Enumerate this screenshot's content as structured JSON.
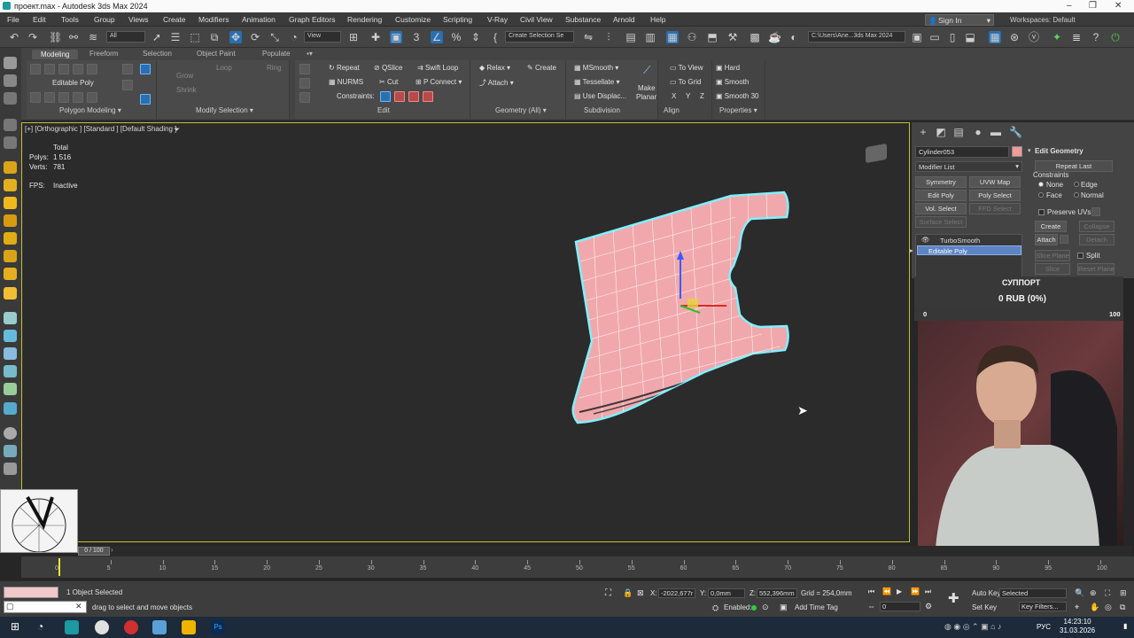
{
  "app": {
    "title": "проект.max - Autodesk 3ds Max 2024"
  },
  "menu": [
    "File",
    "Edit",
    "Tools",
    "Group",
    "Views",
    "Create",
    "Modifiers",
    "Animation",
    "Graph Editors",
    "Rendering",
    "Customize",
    "Scripting",
    "V-Ray",
    "Civil View",
    "Substance",
    "Arnold",
    "Help"
  ],
  "signin": {
    "label": "Sign In"
  },
  "workspaces": {
    "label": "Workspaces:",
    "value": "Default"
  },
  "toolbar": {
    "filter": "All",
    "refcoord": "View",
    "selset": "Create Selection Se",
    "path": "C:\\Users\\Ane...3ds Max 2024"
  },
  "ribbon": {
    "tabs": [
      "Modeling",
      "Freeform",
      "Selection",
      "Object Paint",
      "Populate"
    ],
    "editable_poly": "Editable Poly",
    "sel_grey": {
      "grow": "Grow",
      "shrink": "Shrink",
      "loop": "Loop",
      "ring": "Ring"
    },
    "edit": {
      "repeat": "Repeat",
      "qslice": "QSlice",
      "swift_loop": "Swift Loop",
      "nurms": "NURMS",
      "cut": "Cut",
      "p_connect": "P Connect",
      "constraints": "Constraints:"
    },
    "geometry": {
      "relax": "Relax",
      "create": "Create",
      "attach": "Attach"
    },
    "subdivision": {
      "msmooth": "MSmooth",
      "tessellate": "Tessellate",
      "use_displac": "Use Displac..."
    },
    "align": {
      "make_planar_1": "Make",
      "make_planar_2": "Planar",
      "to_view": "To View",
      "to_grid": "To Grid",
      "xyz": [
        "X",
        "Y",
        "Z"
      ]
    },
    "properties": {
      "hard": "Hard",
      "smooth": "Smooth",
      "smooth30": "Smooth 30"
    },
    "footers": [
      "Polygon Modeling",
      "Modify Selection",
      "Edit",
      "Geometry (All)",
      "Subdivision",
      "Align",
      "Properties"
    ]
  },
  "viewport": {
    "label": "[+] [Orthographic ] [Standard ] [Default Shading ]",
    "stats": {
      "total": "Total",
      "polys_label": "Polys:",
      "polys": "1 516",
      "verts_label": "Verts:",
      "verts": "781",
      "fps_label": "FPS:",
      "fps": "Inactive"
    }
  },
  "cmd": {
    "object_name": "Cylinder053",
    "modifier_list": "Modifier List",
    "buttons": {
      "symmetry": "Symmetry",
      "uvw_map": "UVW Map",
      "edit_poly": "Edit Poly",
      "poly_select": "Poly Select",
      "vol_select": "Vol. Select",
      "ffd_select": "FFD Select",
      "surface_select": "Surface Select"
    },
    "stack": [
      "TurboSmooth",
      "Editable Poly"
    ]
  },
  "edit_geometry": {
    "title": "Edit Geometry",
    "repeat_last": "Repeat Last",
    "constraints": "Constraints",
    "none": "None",
    "edge": "Edge",
    "face": "Face",
    "normal": "Normal",
    "preserve_uvs": "Preserve UVs",
    "create": "Create",
    "collapse": "Collapse",
    "attach": "Attach",
    "detach": "Detach",
    "slice_plane": "Slice Plane",
    "split": "Split",
    "slice": "Slice",
    "reset_plane": "Reset Plane"
  },
  "overlay": {
    "support": "СУППОРТ",
    "amount": "0 RUB (0%)",
    "min": "0",
    "max": "100"
  },
  "timeline": {
    "ticks": [
      "0",
      "5",
      "10",
      "15",
      "20",
      "25",
      "30",
      "35",
      "40",
      "45",
      "50",
      "55",
      "60",
      "65",
      "70",
      "75",
      "80",
      "85",
      "90",
      "95",
      "100"
    ],
    "frame": "0 / 100"
  },
  "status": {
    "selected": "1 Object Selected",
    "hint": "drag to select and move objects",
    "x_label": "X:",
    "x": "-2022,677r",
    "y_label": "Y:",
    "y": "0,0mm",
    "z_label": "Z:",
    "z": "552,396mm",
    "grid": "Grid = 254,0mm",
    "enabled": "Enabled:",
    "add_time_tag": "Add Time Tag",
    "auto_key": "Auto Key",
    "set_key": "Set Key",
    "selected_dd": "Selected",
    "key_filters": "Key Filters...",
    "frame_field": "0"
  },
  "taskbar": {
    "lang": "РУС",
    "time": "14:23:10",
    "date": "31.03.2026"
  },
  "colors": {
    "viewport_border": "#c6c034",
    "object": "#f1a8ac",
    "wire": "#ffffff",
    "selection_outline": "#7ff0ff",
    "stack_active": "#5d85c5"
  }
}
